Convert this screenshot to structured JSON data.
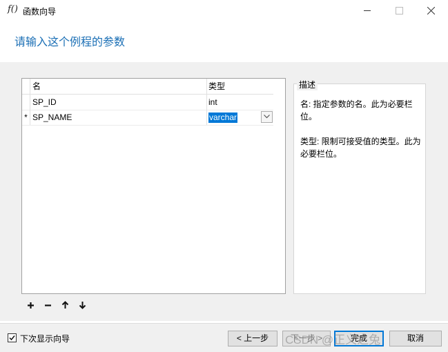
{
  "window": {
    "title": "函数向导",
    "app_icon": "f()"
  },
  "page": {
    "heading": "请输入这个例程的参数"
  },
  "grid": {
    "columns": [
      "名",
      "类型"
    ],
    "rows": [
      {
        "indicator": "",
        "name": "SP_ID",
        "type": "int"
      },
      {
        "indicator": "*",
        "name": "SP_NAME",
        "type": "varchar"
      }
    ]
  },
  "description": {
    "title": "描述",
    "paragraphs": [
      "名: 指定参数的名。此为必要栏位。",
      "类型: 限制可接受值的类型。此为必要栏位。"
    ]
  },
  "toolbar": {
    "add": "+",
    "remove": "−",
    "up": "↑",
    "down": "↓"
  },
  "footer": {
    "checkbox_label": "下次显示向导",
    "checked": true,
    "prev_label": "< 上一步",
    "next_label": "下一步 >",
    "finish_label": "完成",
    "cancel_label": "取消"
  },
  "watermark": "CSDN @正义之兔"
}
